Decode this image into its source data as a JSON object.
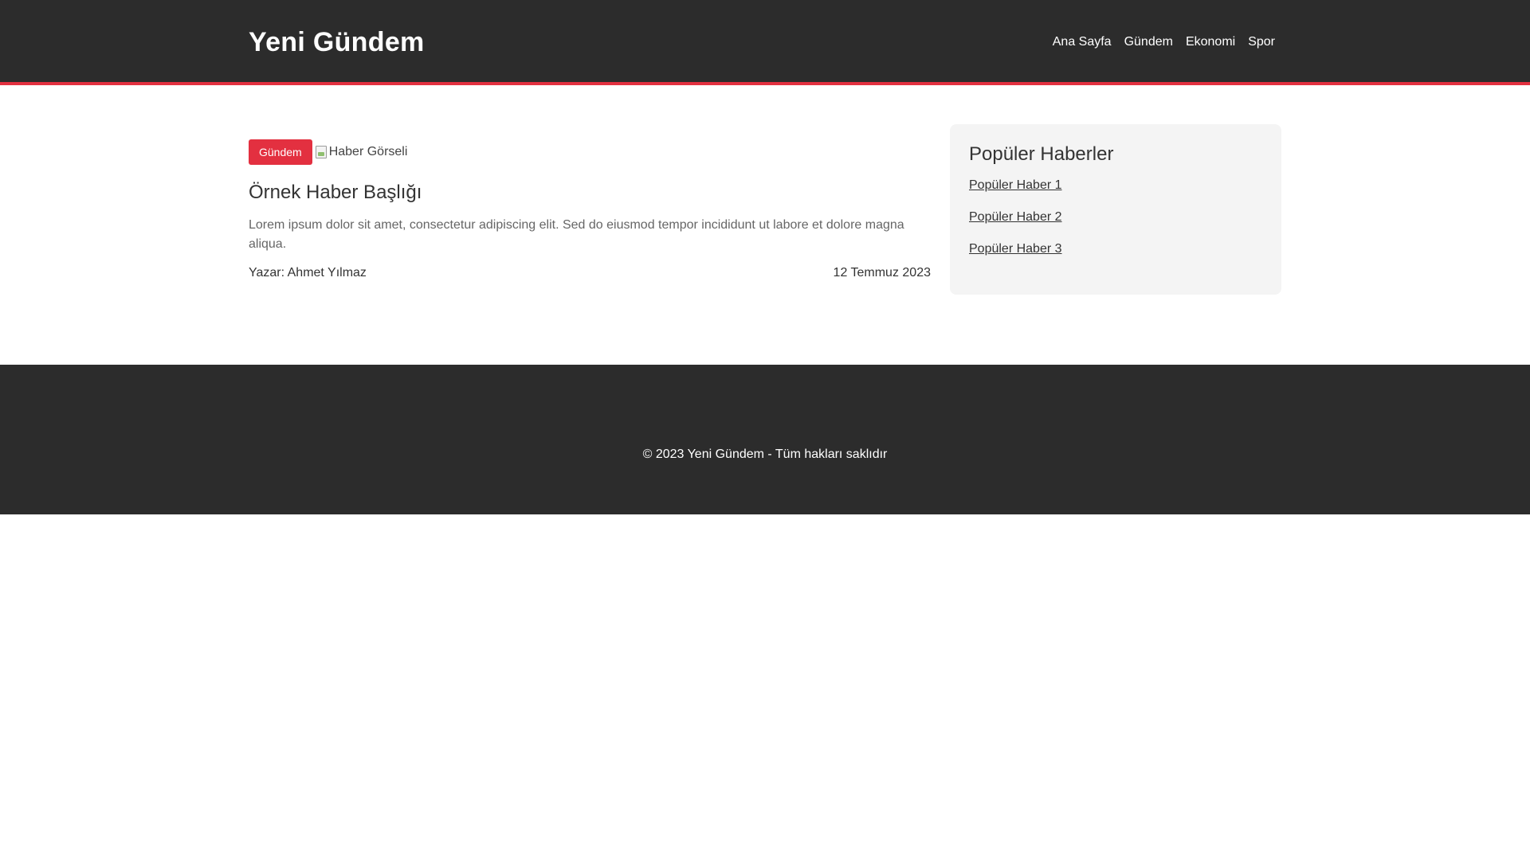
{
  "header": {
    "logo": "Yeni Gündem",
    "nav": [
      {
        "label": "Ana Sayfa"
      },
      {
        "label": "Gündem"
      },
      {
        "label": "Ekonomi"
      },
      {
        "label": "Spor"
      }
    ]
  },
  "article": {
    "category": "Gündem",
    "image_alt": "Haber Görseli",
    "title": "Örnek Haber Başlığı",
    "summary": "Lorem ipsum dolor sit amet, consectetur adipiscing elit. Sed do eiusmod tempor incididunt ut labore et dolore magna aliqua.",
    "author": "Yazar: Ahmet Yılmaz",
    "date": "12 Temmuz 2023"
  },
  "sidebar": {
    "title": "Popüler Haberler",
    "items": [
      {
        "label": "Popüler Haber 1"
      },
      {
        "label": "Popüler Haber 2"
      },
      {
        "label": "Popüler Haber 3"
      }
    ]
  },
  "footer": {
    "copyright": "© 2023 Yeni Gündem - Tüm hakları saklıdır"
  },
  "colors": {
    "header_bg": "#2c2c2c",
    "accent": "#e33040",
    "sidebar_bg": "#f4f4f4"
  }
}
